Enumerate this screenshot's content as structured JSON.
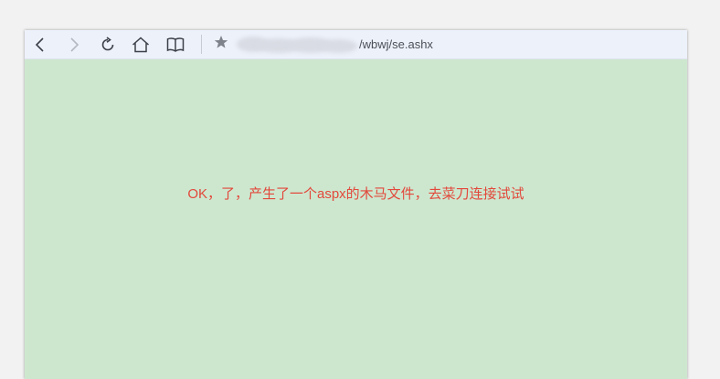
{
  "browser": {
    "toolbar": {
      "buttons": [
        {
          "name": "back-button",
          "icon": "chevron-left-icon"
        },
        {
          "name": "forward-button",
          "icon": "chevron-right-icon"
        },
        {
          "name": "refresh-button",
          "icon": "refresh-icon"
        },
        {
          "name": "home-button",
          "icon": "home-icon"
        },
        {
          "name": "reading-view-button",
          "icon": "book-icon"
        }
      ],
      "favorite_icon": "star-icon"
    },
    "address_bar": {
      "url_visible": "/wbwj/se.ashx",
      "url_prefix_obscured": true
    }
  },
  "page": {
    "message": "OK，了，产生了一个aspx的木马文件，去菜刀连接试试",
    "message_color": "#e2483b",
    "background_color": "#cde7cf"
  }
}
